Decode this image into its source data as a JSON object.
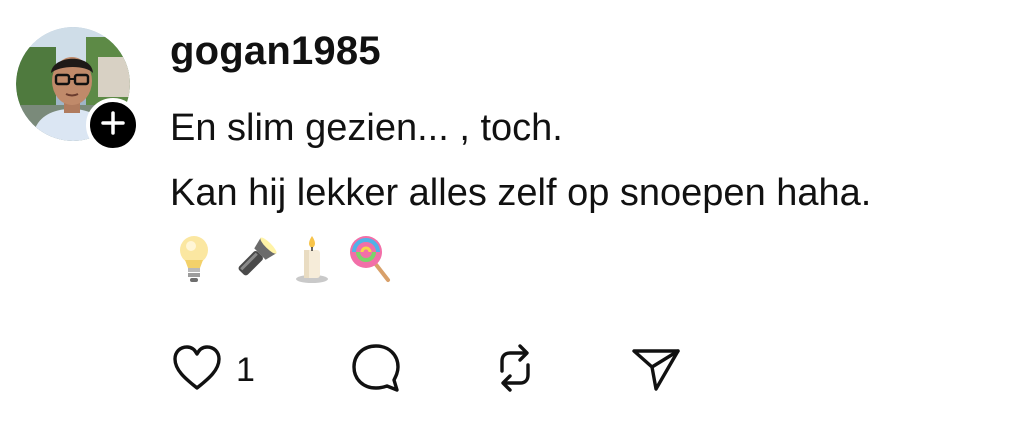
{
  "post": {
    "username": "gogan1985",
    "text_lines": [
      "En slim gezien... , toch.",
      "Kan hij lekker alles zelf op snoepen haha."
    ],
    "emojis": [
      "lightbulb-emoji",
      "flashlight-emoji",
      "candle-emoji",
      "lollipop-emoji"
    ],
    "actions": {
      "like_count": "1"
    }
  },
  "icons": {
    "follow": "plus-icon",
    "like": "heart-icon",
    "comment": "comment-bubble-icon",
    "repost": "repost-icon",
    "share": "send-icon"
  },
  "colors": {
    "text": "#111111",
    "badge": "#000000",
    "background": "#ffffff"
  }
}
